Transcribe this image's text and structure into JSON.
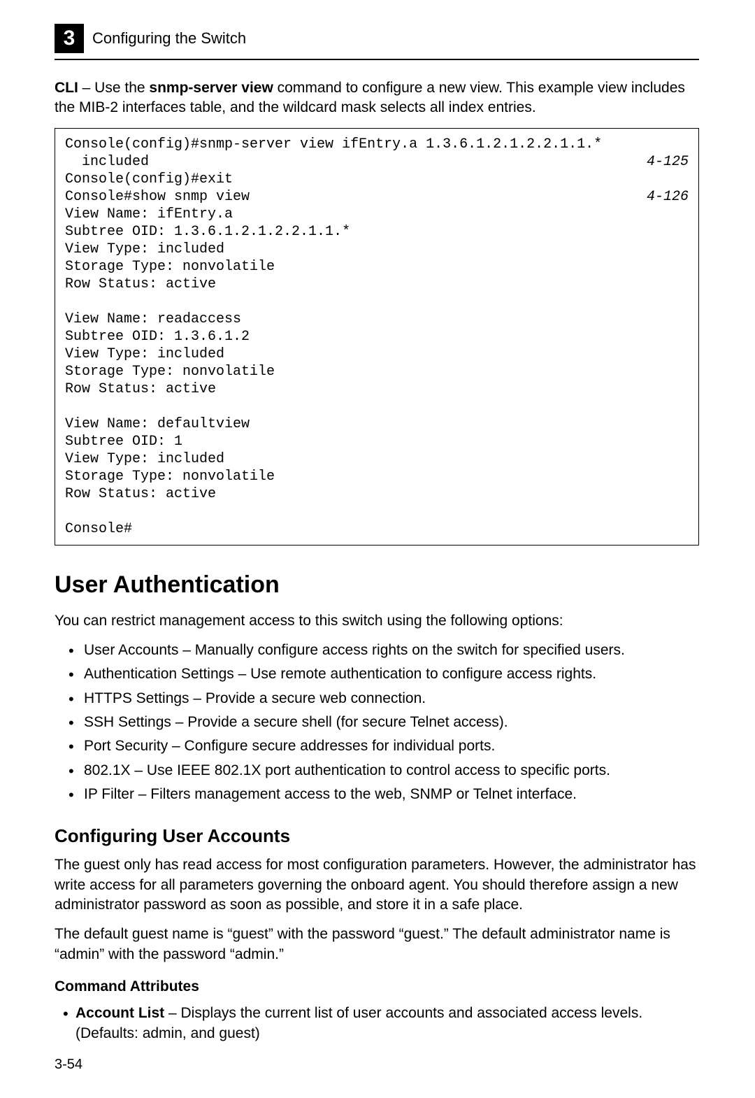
{
  "header": {
    "chapter_number": "3",
    "title": "Configuring the Switch"
  },
  "intro": {
    "prefix_bold": "CLI",
    "dash": " – Use the ",
    "cmd_bold": "snmp-server view",
    "rest": " command to configure a new view. This example view includes the MIB-2 interfaces table, and the wildcard mask selects all index entries."
  },
  "code": {
    "l1a": "Console(config)#snmp-server view ifEntry.a 1.3.6.1.2.1.2.2.1.1.*",
    "l1b": "  included",
    "ref1": "4-125",
    "l2": "Console(config)#exit",
    "l3": "Console#show snmp view",
    "ref2": "4-126",
    "l4": "View Name: ifEntry.a",
    "l5": "Subtree OID: 1.3.6.1.2.1.2.2.1.1.*",
    "l6": "View Type: included",
    "l7": "Storage Type: nonvolatile",
    "l8": "Row Status: active",
    "blank1": " ",
    "l9": "View Name: readaccess",
    "l10": "Subtree OID: 1.3.6.1.2",
    "l11": "View Type: included",
    "l12": "Storage Type: nonvolatile",
    "l13": "Row Status: active",
    "blank2": " ",
    "l14": "View Name: defaultview",
    "l15": "Subtree OID: 1",
    "l16": "View Type: included",
    "l17": "Storage Type: nonvolatile",
    "l18": "Row Status: active",
    "blank3": " ",
    "l19": "Console#"
  },
  "section": {
    "title": "User Authentication",
    "intro": "You can restrict management access to this switch using the following options:",
    "bullets": [
      "User Accounts – Manually configure access rights on the switch for specified users.",
      "Authentication Settings – Use remote authentication to configure access rights.",
      "HTTPS Settings – Provide a secure web connection.",
      "SSH Settings – Provide a secure shell (for secure Telnet access).",
      "Port Security – Configure secure addresses for individual ports.",
      "802.1X – Use IEEE 802.1X port authentication to control access to specific ports.",
      "IP Filter – Filters management access to the web, SNMP or Telnet interface."
    ]
  },
  "subsection": {
    "title": "Configuring User Accounts",
    "p1": "The guest only has read access for most configuration parameters. However, the administrator has write access for all parameters governing the onboard agent. You should therefore assign a new administrator password as soon as possible, and store it in a safe place.",
    "p2": "The default guest name is “guest” with the password “guest.” The default administrator name is “admin” with the password “admin.”",
    "cmd_attr_title": "Command Attributes",
    "attr_bold": "Account List",
    "attr_rest": " – Displays the current list of user accounts and associated access levels. (Defaults: admin, and guest)"
  },
  "page_number": "3-54"
}
